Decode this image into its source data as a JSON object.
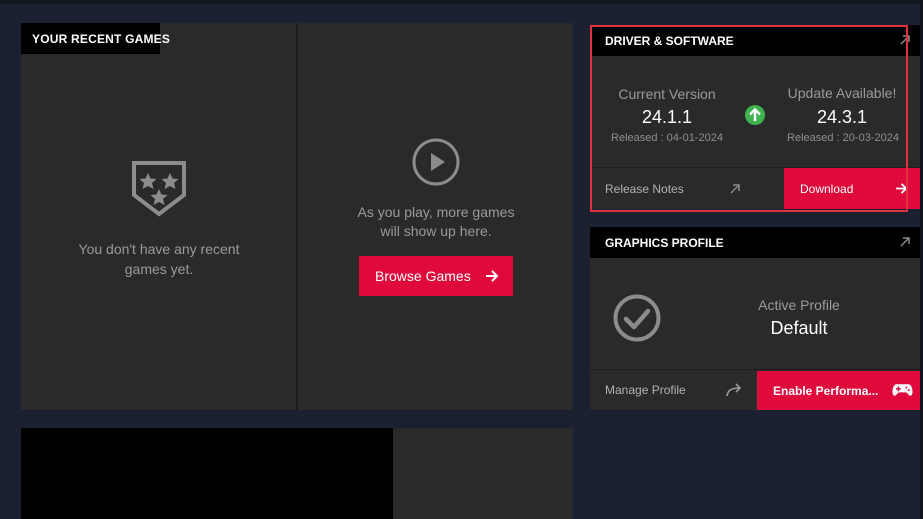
{
  "recent_games": {
    "title": "YOUR RECENT GAMES",
    "empty_text": "You don't have any recent games yet.",
    "play_text": "As you play, more games will show up here.",
    "browse_label": "Browse Games"
  },
  "driver": {
    "title": "DRIVER & SOFTWARE",
    "current_label": "Current Version",
    "current_version": "24.1.1",
    "current_released": "Released : 04-01-2024",
    "update_label": "Update Available!",
    "update_version": "24.3.1",
    "update_released": "Released : 20-03-2024",
    "release_notes_label": "Release Notes",
    "download_label": "Download"
  },
  "graphics": {
    "title": "GRAPHICS PROFILE",
    "active_label": "Active Profile",
    "active_value": "Default",
    "manage_label": "Manage Profile",
    "enable_label": "Enable Performa..."
  },
  "colors": {
    "accent": "#e0093c",
    "update_arrow": "#3fb34f",
    "highlight_box": "#e0313f"
  }
}
